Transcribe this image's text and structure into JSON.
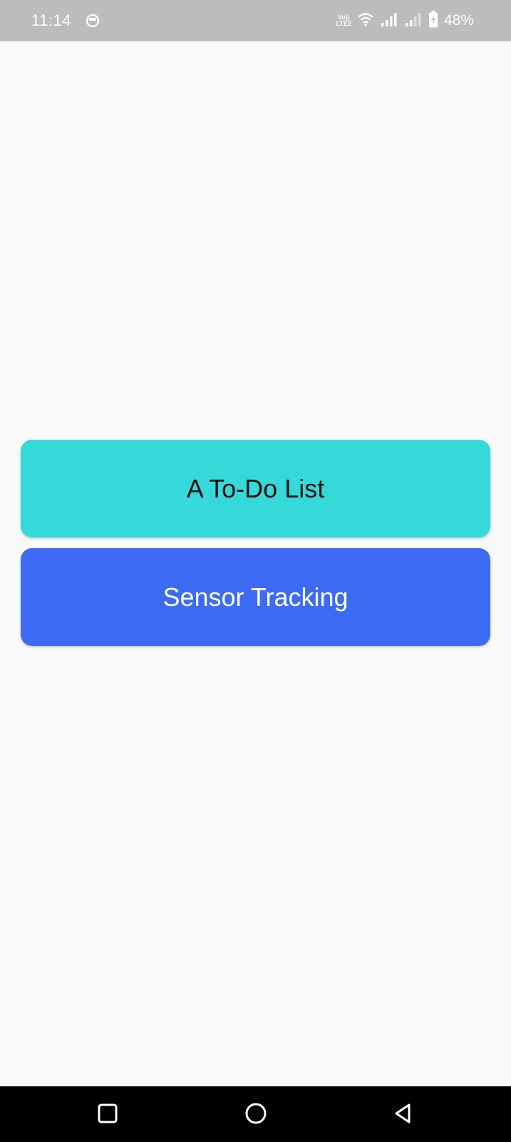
{
  "status_bar": {
    "time": "11:14",
    "network_top": "Vo))",
    "network_bottom": "LTE2",
    "battery_percent": "48%",
    "icons": [
      "app-notification-icon",
      "wifi-icon",
      "signal-icon",
      "signal-weak-icon",
      "battery-charging-icon"
    ]
  },
  "main": {
    "buttons": [
      {
        "label": "A To-Do List",
        "color": "#36d9d9"
      },
      {
        "label": "Sensor Tracking",
        "color": "#3d6bf4"
      }
    ]
  },
  "nav_bar": {
    "icons": [
      "recents-square-icon",
      "home-circle-icon",
      "back-triangle-icon"
    ]
  }
}
